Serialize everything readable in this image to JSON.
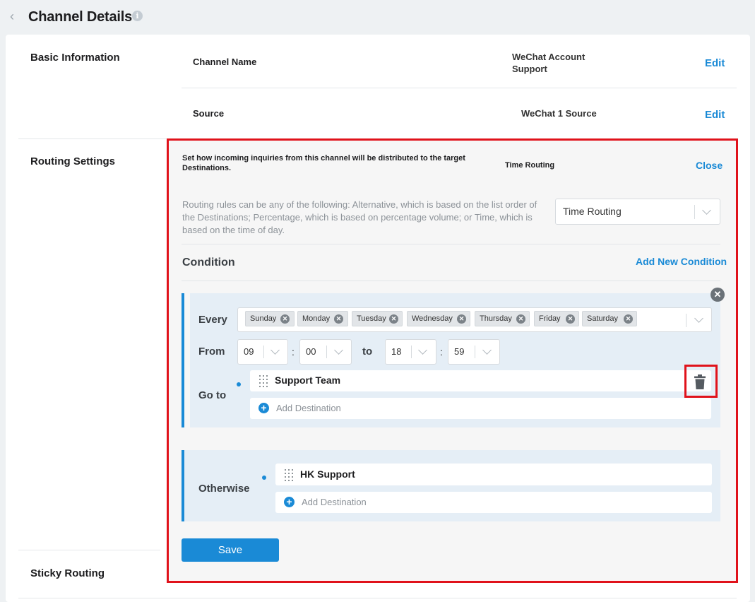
{
  "header": {
    "title": "Channel Details",
    "info_icon": "i"
  },
  "basic_information": {
    "label": "Basic Information",
    "rows": [
      {
        "label": "Channel Name",
        "value": "WeChat Account Support",
        "action": "Edit"
      },
      {
        "label": "Source",
        "value": "WeChat 1 Source",
        "action": "Edit"
      }
    ]
  },
  "routing": {
    "label": "Routing Settings",
    "intro": "Set how incoming inquiries from this channel will be distributed to the target Destinations.",
    "current_type": "Time Routing",
    "close_label": "Close",
    "help_text": "Routing rules can be any of the following: Alternative, which is based on the list order of the Destinations; Percentage, which is based on percentage volume; or Time, which is based on the time of day.",
    "selected_type": "Time Routing",
    "condition_heading": "Condition",
    "add_condition_label": "Add New Condition",
    "condition": {
      "every_label": "Every",
      "days": [
        "Sunday",
        "Monday",
        "Tuesday",
        "Wednesday",
        "Thursday",
        "Friday",
        "Saturday"
      ],
      "from_label": "From",
      "from_hour": "09",
      "from_minute": "00",
      "to_label": "to",
      "to_hour": "18",
      "to_minute": "59",
      "time_separator": ":",
      "goto_label": "Go to",
      "destination": "Support Team",
      "add_destination_label": "Add Destination"
    },
    "otherwise": {
      "label": "Otherwise",
      "destination": "HK Support",
      "add_destination_label": "Add Destination"
    },
    "save_label": "Save"
  },
  "sticky_routing": {
    "label": "Sticky Routing"
  },
  "colors": {
    "accent": "#1a8ad6",
    "highlight": "#e0121b",
    "condition_bg": "#e5eef6"
  }
}
